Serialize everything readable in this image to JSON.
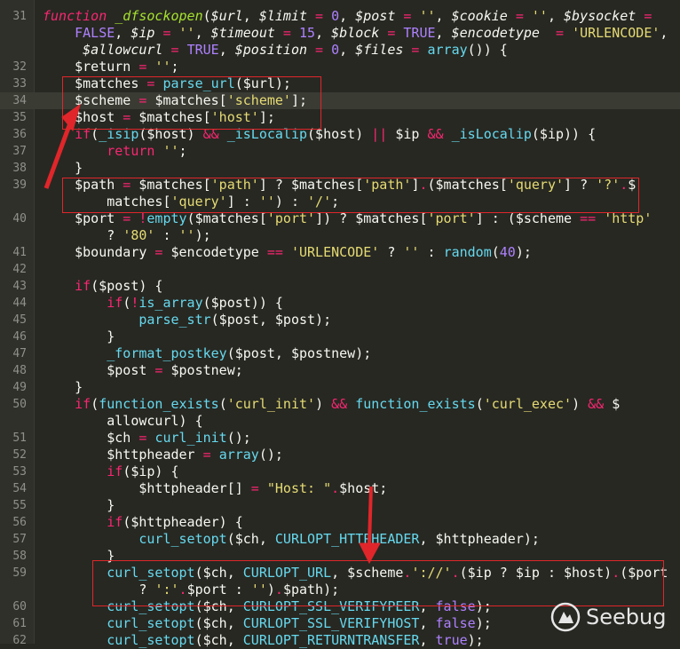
{
  "editor": {
    "lines": [
      {
        "n": "31",
        "tokens": [
          [
            "t-kw t-it",
            "function "
          ],
          [
            "t-fnd t-it",
            "_dfsockopen"
          ],
          [
            "t-pun",
            "("
          ],
          [
            "t-var t-it",
            "$url"
          ],
          [
            "t-pun",
            ", "
          ],
          [
            "t-var t-it",
            "$limit"
          ],
          [
            "t-op",
            " = "
          ],
          [
            "t-num",
            "0"
          ],
          [
            "t-pun",
            ", "
          ],
          [
            "t-var t-it",
            "$post"
          ],
          [
            "t-op",
            " = "
          ],
          [
            "t-str",
            "''"
          ],
          [
            "t-pun",
            ", "
          ],
          [
            "t-var t-it",
            "$cookie"
          ],
          [
            "t-op",
            " = "
          ],
          [
            "t-str",
            "''"
          ],
          [
            "t-pun",
            ", "
          ],
          [
            "t-var t-it",
            "$bysocket"
          ],
          [
            "t-op",
            " ="
          ]
        ]
      },
      {
        "n": "",
        "tokens": [
          [
            "t-pun",
            "    "
          ],
          [
            "t-const",
            "FALSE"
          ],
          [
            "t-pun",
            ", "
          ],
          [
            "t-var t-it",
            "$ip"
          ],
          [
            "t-op",
            " = "
          ],
          [
            "t-str",
            "''"
          ],
          [
            "t-pun",
            ", "
          ],
          [
            "t-var t-it",
            "$timeout"
          ],
          [
            "t-op",
            " = "
          ],
          [
            "t-num",
            "15"
          ],
          [
            "t-pun",
            ", "
          ],
          [
            "t-var t-it",
            "$block"
          ],
          [
            "t-op",
            " = "
          ],
          [
            "t-const",
            "TRUE"
          ],
          [
            "t-pun",
            ", "
          ],
          [
            "t-var t-it",
            "$encodetype"
          ],
          [
            "t-op",
            "  = "
          ],
          [
            "t-str",
            "'URLENCODE'"
          ],
          [
            "t-pun",
            ","
          ]
        ]
      },
      {
        "n": "",
        "tokens": [
          [
            "t-pun",
            "     "
          ],
          [
            "t-var t-it",
            "$allowcurl"
          ],
          [
            "t-op",
            " = "
          ],
          [
            "t-const",
            "TRUE"
          ],
          [
            "t-pun",
            ", "
          ],
          [
            "t-var t-it",
            "$position"
          ],
          [
            "t-op",
            " = "
          ],
          [
            "t-num",
            "0"
          ],
          [
            "t-pun",
            ", "
          ],
          [
            "t-var t-it",
            "$files"
          ],
          [
            "t-op",
            " = "
          ],
          [
            "t-fn",
            "array"
          ],
          [
            "t-pun",
            "()) {"
          ]
        ]
      },
      {
        "n": "32",
        "tokens": [
          [
            "t-pun",
            "    "
          ],
          [
            "t-var",
            "$return"
          ],
          [
            "t-op",
            " = "
          ],
          [
            "t-str",
            "''"
          ],
          [
            "t-pun",
            ";"
          ]
        ]
      },
      {
        "n": "33",
        "tokens": [
          [
            "t-pun",
            "    "
          ],
          [
            "t-var",
            "$matches"
          ],
          [
            "t-op",
            " = "
          ],
          [
            "t-fn",
            "parse_url"
          ],
          [
            "t-pun",
            "($url);"
          ]
        ]
      },
      {
        "n": "34",
        "tokens": [
          [
            "t-pun",
            "    "
          ],
          [
            "t-var",
            "$scheme"
          ],
          [
            "t-op",
            " = "
          ],
          [
            "t-var",
            "$matches["
          ],
          [
            "t-str",
            "'scheme'"
          ],
          [
            "t-pun",
            "];"
          ]
        ]
      },
      {
        "n": "35",
        "tokens": [
          [
            "t-pun",
            "    "
          ],
          [
            "t-var",
            "$host"
          ],
          [
            "t-op",
            " = "
          ],
          [
            "t-var",
            "$matches["
          ],
          [
            "t-str",
            "'host'"
          ],
          [
            "t-pun",
            "];"
          ]
        ]
      },
      {
        "n": "36",
        "tokens": [
          [
            "t-pun",
            "    "
          ],
          [
            "t-kw",
            "if"
          ],
          [
            "t-pun",
            "("
          ],
          [
            "t-fn",
            "_isip"
          ],
          [
            "t-pun",
            "($host) "
          ],
          [
            "t-op",
            "&&"
          ],
          [
            "t-pun",
            " "
          ],
          [
            "t-fn",
            "_isLocalip"
          ],
          [
            "t-pun",
            "($host) "
          ],
          [
            "t-op",
            "||"
          ],
          [
            "t-pun",
            " $ip "
          ],
          [
            "t-op",
            "&&"
          ],
          [
            "t-pun",
            " "
          ],
          [
            "t-fn",
            "_isLocalip"
          ],
          [
            "t-pun",
            "($ip)) {"
          ]
        ]
      },
      {
        "n": "37",
        "tokens": [
          [
            "t-pun",
            "        "
          ],
          [
            "t-kw",
            "return"
          ],
          [
            "t-pun",
            " "
          ],
          [
            "t-str",
            "''"
          ],
          [
            "t-pun",
            ";"
          ]
        ]
      },
      {
        "n": "38",
        "tokens": [
          [
            "t-pun",
            "    }"
          ]
        ]
      },
      {
        "n": "39",
        "tokens": [
          [
            "t-pun",
            "    "
          ],
          [
            "t-var",
            "$path"
          ],
          [
            "t-op",
            " = "
          ],
          [
            "t-var",
            "$matches["
          ],
          [
            "t-str",
            "'path'"
          ],
          [
            "t-pun",
            "] ? $matches["
          ],
          [
            "t-str",
            "'path'"
          ],
          [
            "t-pun",
            "]"
          ],
          [
            "t-op",
            "."
          ],
          [
            "t-pun",
            "($matches["
          ],
          [
            "t-str",
            "'query'"
          ],
          [
            "t-pun",
            "] ? "
          ],
          [
            "t-str",
            "'?'"
          ],
          [
            "t-op",
            "."
          ],
          [
            "t-pun",
            "$"
          ]
        ]
      },
      {
        "n": "",
        "tokens": [
          [
            "t-pun",
            "        matches["
          ],
          [
            "t-str",
            "'query'"
          ],
          [
            "t-pun",
            "] : "
          ],
          [
            "t-str",
            "''"
          ],
          [
            "t-pun",
            ") : "
          ],
          [
            "t-str",
            "'/'"
          ],
          [
            "t-pun",
            ";"
          ]
        ]
      },
      {
        "n": "40",
        "tokens": [
          [
            "t-pun",
            "    "
          ],
          [
            "t-var",
            "$port"
          ],
          [
            "t-op",
            " = !"
          ],
          [
            "t-fn",
            "empty"
          ],
          [
            "t-pun",
            "($matches["
          ],
          [
            "t-str",
            "'port'"
          ],
          [
            "t-pun",
            "]) ? $matches["
          ],
          [
            "t-str",
            "'port'"
          ],
          [
            "t-pun",
            "] : ($scheme "
          ],
          [
            "t-op",
            "=="
          ],
          [
            "t-pun",
            " "
          ],
          [
            "t-str",
            "'http'"
          ]
        ]
      },
      {
        "n": "",
        "tokens": [
          [
            "t-pun",
            "        ? "
          ],
          [
            "t-str",
            "'80'"
          ],
          [
            "t-pun",
            " : "
          ],
          [
            "t-str",
            "''"
          ],
          [
            "t-pun",
            ");"
          ]
        ]
      },
      {
        "n": "41",
        "tokens": [
          [
            "t-pun",
            "    "
          ],
          [
            "t-var",
            "$boundary"
          ],
          [
            "t-op",
            " = "
          ],
          [
            "t-pun",
            "$encodetype "
          ],
          [
            "t-op",
            "=="
          ],
          [
            "t-pun",
            " "
          ],
          [
            "t-str",
            "'URLENCODE'"
          ],
          [
            "t-pun",
            " ? "
          ],
          [
            "t-str",
            "''"
          ],
          [
            "t-pun",
            " : "
          ],
          [
            "t-fn",
            "random"
          ],
          [
            "t-pun",
            "("
          ],
          [
            "t-num",
            "40"
          ],
          [
            "t-pun",
            ");"
          ]
        ]
      },
      {
        "n": "42",
        "tokens": []
      },
      {
        "n": "43",
        "tokens": [
          [
            "t-pun",
            "    "
          ],
          [
            "t-kw",
            "if"
          ],
          [
            "t-pun",
            "($post) {"
          ]
        ]
      },
      {
        "n": "44",
        "tokens": [
          [
            "t-pun",
            "        "
          ],
          [
            "t-kw",
            "if"
          ],
          [
            "t-pun",
            "("
          ],
          [
            "t-op",
            "!"
          ],
          [
            "t-fn",
            "is_array"
          ],
          [
            "t-pun",
            "($post)) {"
          ]
        ]
      },
      {
        "n": "45",
        "tokens": [
          [
            "t-pun",
            "            "
          ],
          [
            "t-fn",
            "parse_str"
          ],
          [
            "t-pun",
            "($post, $post);"
          ]
        ]
      },
      {
        "n": "46",
        "tokens": [
          [
            "t-pun",
            "        }"
          ]
        ]
      },
      {
        "n": "47",
        "tokens": [
          [
            "t-pun",
            "        "
          ],
          [
            "t-fn",
            "_format_postkey"
          ],
          [
            "t-pun",
            "($post, $postnew);"
          ]
        ]
      },
      {
        "n": "48",
        "tokens": [
          [
            "t-pun",
            "        "
          ],
          [
            "t-var",
            "$post"
          ],
          [
            "t-op",
            " = "
          ],
          [
            "t-pun",
            "$postnew;"
          ]
        ]
      },
      {
        "n": "49",
        "tokens": [
          [
            "t-pun",
            "    }"
          ]
        ]
      },
      {
        "n": "50",
        "tokens": [
          [
            "t-pun",
            "    "
          ],
          [
            "t-kw",
            "if"
          ],
          [
            "t-pun",
            "("
          ],
          [
            "t-fn",
            "function_exists"
          ],
          [
            "t-pun",
            "("
          ],
          [
            "t-str",
            "'curl_init'"
          ],
          [
            "t-pun",
            ") "
          ],
          [
            "t-op",
            "&&"
          ],
          [
            "t-pun",
            " "
          ],
          [
            "t-fn",
            "function_exists"
          ],
          [
            "t-pun",
            "("
          ],
          [
            "t-str",
            "'curl_exec'"
          ],
          [
            "t-pun",
            ") "
          ],
          [
            "t-op",
            "&&"
          ],
          [
            "t-pun",
            " $"
          ]
        ]
      },
      {
        "n": "",
        "tokens": [
          [
            "t-pun",
            "        allowcurl) {"
          ]
        ]
      },
      {
        "n": "51",
        "tokens": [
          [
            "t-pun",
            "        "
          ],
          [
            "t-var",
            "$ch"
          ],
          [
            "t-op",
            " = "
          ],
          [
            "t-fn",
            "curl_init"
          ],
          [
            "t-pun",
            "();"
          ]
        ]
      },
      {
        "n": "52",
        "tokens": [
          [
            "t-pun",
            "        "
          ],
          [
            "t-var",
            "$httpheader"
          ],
          [
            "t-op",
            " = "
          ],
          [
            "t-fn",
            "array"
          ],
          [
            "t-pun",
            "();"
          ]
        ]
      },
      {
        "n": "53",
        "tokens": [
          [
            "t-pun",
            "        "
          ],
          [
            "t-kw",
            "if"
          ],
          [
            "t-pun",
            "($ip) {"
          ]
        ]
      },
      {
        "n": "54",
        "tokens": [
          [
            "t-pun",
            "            "
          ],
          [
            "t-var",
            "$httpheader[]"
          ],
          [
            "t-op",
            " = "
          ],
          [
            "t-str",
            "\"Host: \""
          ],
          [
            "t-op",
            "."
          ],
          [
            "t-pun",
            "$host;"
          ]
        ]
      },
      {
        "n": "55",
        "tokens": [
          [
            "t-pun",
            "        }"
          ]
        ]
      },
      {
        "n": "56",
        "tokens": [
          [
            "t-pun",
            "        "
          ],
          [
            "t-kw",
            "if"
          ],
          [
            "t-pun",
            "($httpheader) {"
          ]
        ]
      },
      {
        "n": "57",
        "tokens": [
          [
            "t-pun",
            "            "
          ],
          [
            "t-fn",
            "curl_setopt"
          ],
          [
            "t-pun",
            "($ch, "
          ],
          [
            "t-fn",
            "CURLOPT_HTTPHEADER"
          ],
          [
            "t-pun",
            ", $httpheader);"
          ]
        ]
      },
      {
        "n": "58",
        "tokens": [
          [
            "t-pun",
            "        }"
          ]
        ]
      },
      {
        "n": "59",
        "tokens": [
          [
            "t-pun",
            "        "
          ],
          [
            "t-fn",
            "curl_setopt"
          ],
          [
            "t-pun",
            "($ch, "
          ],
          [
            "t-fn",
            "CURLOPT_URL"
          ],
          [
            "t-pun",
            ", $scheme"
          ],
          [
            "t-op",
            "."
          ],
          [
            "t-str",
            "'://'"
          ],
          [
            "t-op",
            "."
          ],
          [
            "t-pun",
            "($ip ? $ip : $host)"
          ],
          [
            "t-op",
            "."
          ],
          [
            "t-pun",
            "($port"
          ]
        ]
      },
      {
        "n": "",
        "tokens": [
          [
            "t-pun",
            "            ? "
          ],
          [
            "t-str",
            "':'"
          ],
          [
            "t-op",
            "."
          ],
          [
            "t-pun",
            "$port : "
          ],
          [
            "t-str",
            "''"
          ],
          [
            "t-pun",
            ")"
          ],
          [
            "t-op",
            "."
          ],
          [
            "t-pun",
            "$path);"
          ]
        ]
      },
      {
        "n": "60",
        "tokens": [
          [
            "t-pun",
            "        "
          ],
          [
            "t-fn",
            "curl_setopt"
          ],
          [
            "t-pun",
            "($ch, "
          ],
          [
            "t-fn",
            "CURLOPT_SSL_VERIFYPEER"
          ],
          [
            "t-pun",
            ", "
          ],
          [
            "t-const",
            "false"
          ],
          [
            "t-pun",
            ");"
          ]
        ]
      },
      {
        "n": "61",
        "tokens": [
          [
            "t-pun",
            "        "
          ],
          [
            "t-fn",
            "curl_setopt"
          ],
          [
            "t-pun",
            "($ch, "
          ],
          [
            "t-fn",
            "CURLOPT_SSL_VERIFYHOST"
          ],
          [
            "t-pun",
            ", "
          ],
          [
            "t-const",
            "false"
          ],
          [
            "t-pun",
            ");"
          ]
        ]
      },
      {
        "n": "62",
        "tokens": [
          [
            "t-pun",
            "        "
          ],
          [
            "t-fn",
            "curl_setopt"
          ],
          [
            "t-pun",
            "($ch, "
          ],
          [
            "t-fn",
            "CURLOPT_RETURNTRANSFER"
          ],
          [
            "t-pun",
            ", "
          ],
          [
            "t-const",
            "true"
          ],
          [
            "t-pun",
            ");"
          ]
        ]
      }
    ],
    "current_line": "34"
  },
  "watermark": {
    "text": "Seebug"
  },
  "colors": {
    "background": "#272822",
    "highlight_box": "#e0262a",
    "arrow": "#e0262a"
  }
}
